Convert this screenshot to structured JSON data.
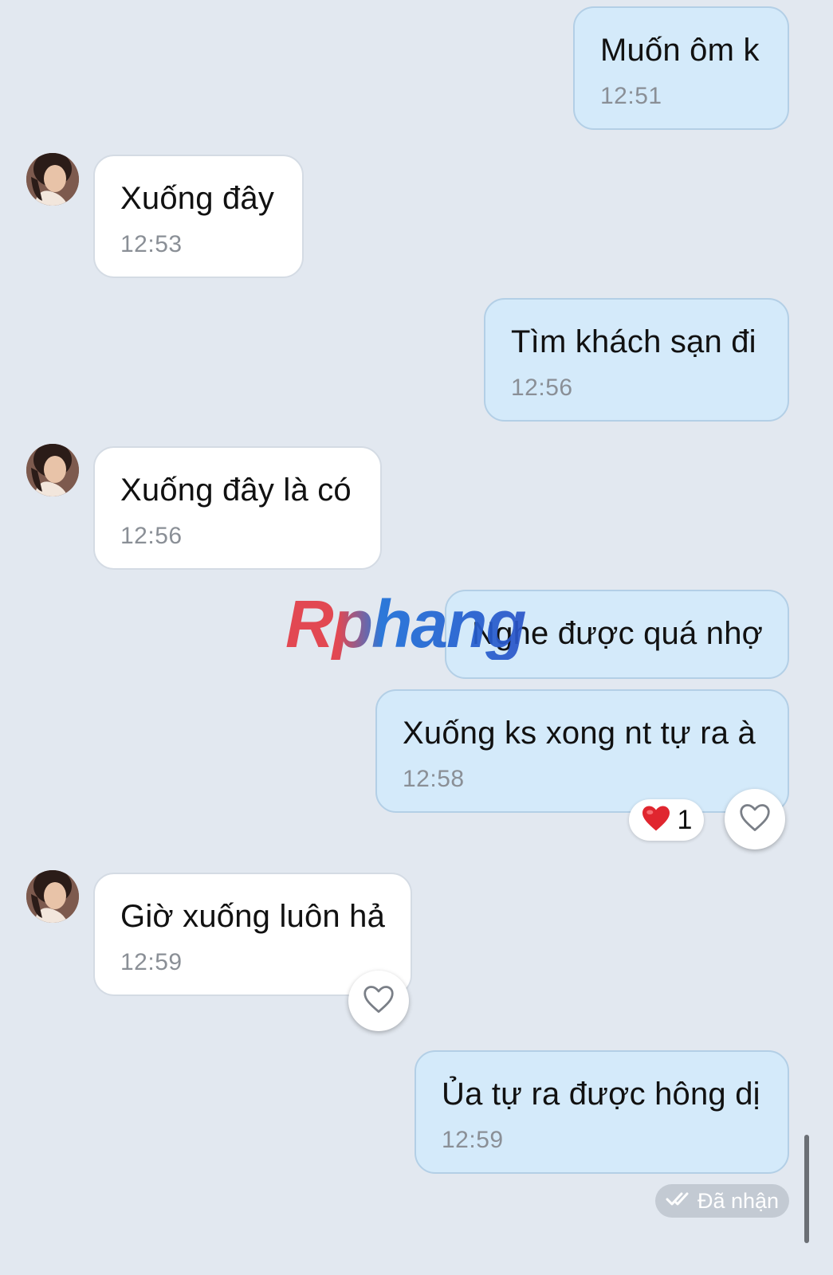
{
  "colors": {
    "background": "#e2e8f0",
    "outgoing_bubble": "#d4eafa",
    "incoming_bubble": "#ffffff",
    "heart": "#e0262f"
  },
  "messages": [
    {
      "direction": "outgoing",
      "text": "Muốn ôm k",
      "time": "12:51"
    },
    {
      "direction": "incoming",
      "text": "Xuống đây",
      "time": "12:53"
    },
    {
      "direction": "outgoing",
      "text": "Tìm khách sạn đi",
      "time": "12:56"
    },
    {
      "direction": "incoming",
      "text": "Xuống đây là có",
      "time": "12:56"
    },
    {
      "direction": "outgoing",
      "text": "Nghe được quá nhợ"
    },
    {
      "direction": "outgoing",
      "text": "Xuống ks xong nt tự ra à",
      "time": "12:58",
      "reaction": {
        "icon": "red-heart-icon",
        "count": "1"
      }
    },
    {
      "direction": "incoming",
      "text": "Giờ xuống luôn hả",
      "time": "12:59"
    },
    {
      "direction": "outgoing",
      "text": "Ủa tự ra được hông dị",
      "time": "12:59"
    }
  ],
  "watermark": "Rphang",
  "status": {
    "icon": "double-check-icon",
    "label": "Đã nhận"
  }
}
